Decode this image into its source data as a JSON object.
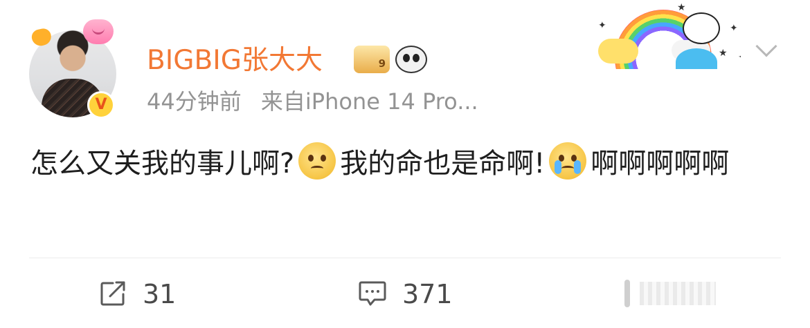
{
  "post": {
    "user": {
      "name": "BIGBIG张大大",
      "avatar_icon": "user-avatar",
      "verified_badge": "V"
    },
    "badges": {
      "crown_level": "9"
    },
    "meta": {
      "time": "44分钟前",
      "source": "来自iPhone 14 Pro..."
    },
    "content": {
      "part1": "怎么又关我的事儿啊?",
      "part2": "我的命也是命啊!",
      "part3": "啊啊啊啊啊"
    },
    "actions": {
      "share_count": "31",
      "comment_count": "371"
    }
  },
  "colors": {
    "username": "#f27834",
    "meta_text": "#939393",
    "body_text": "#1e1e1e",
    "divider": "#ececec"
  }
}
